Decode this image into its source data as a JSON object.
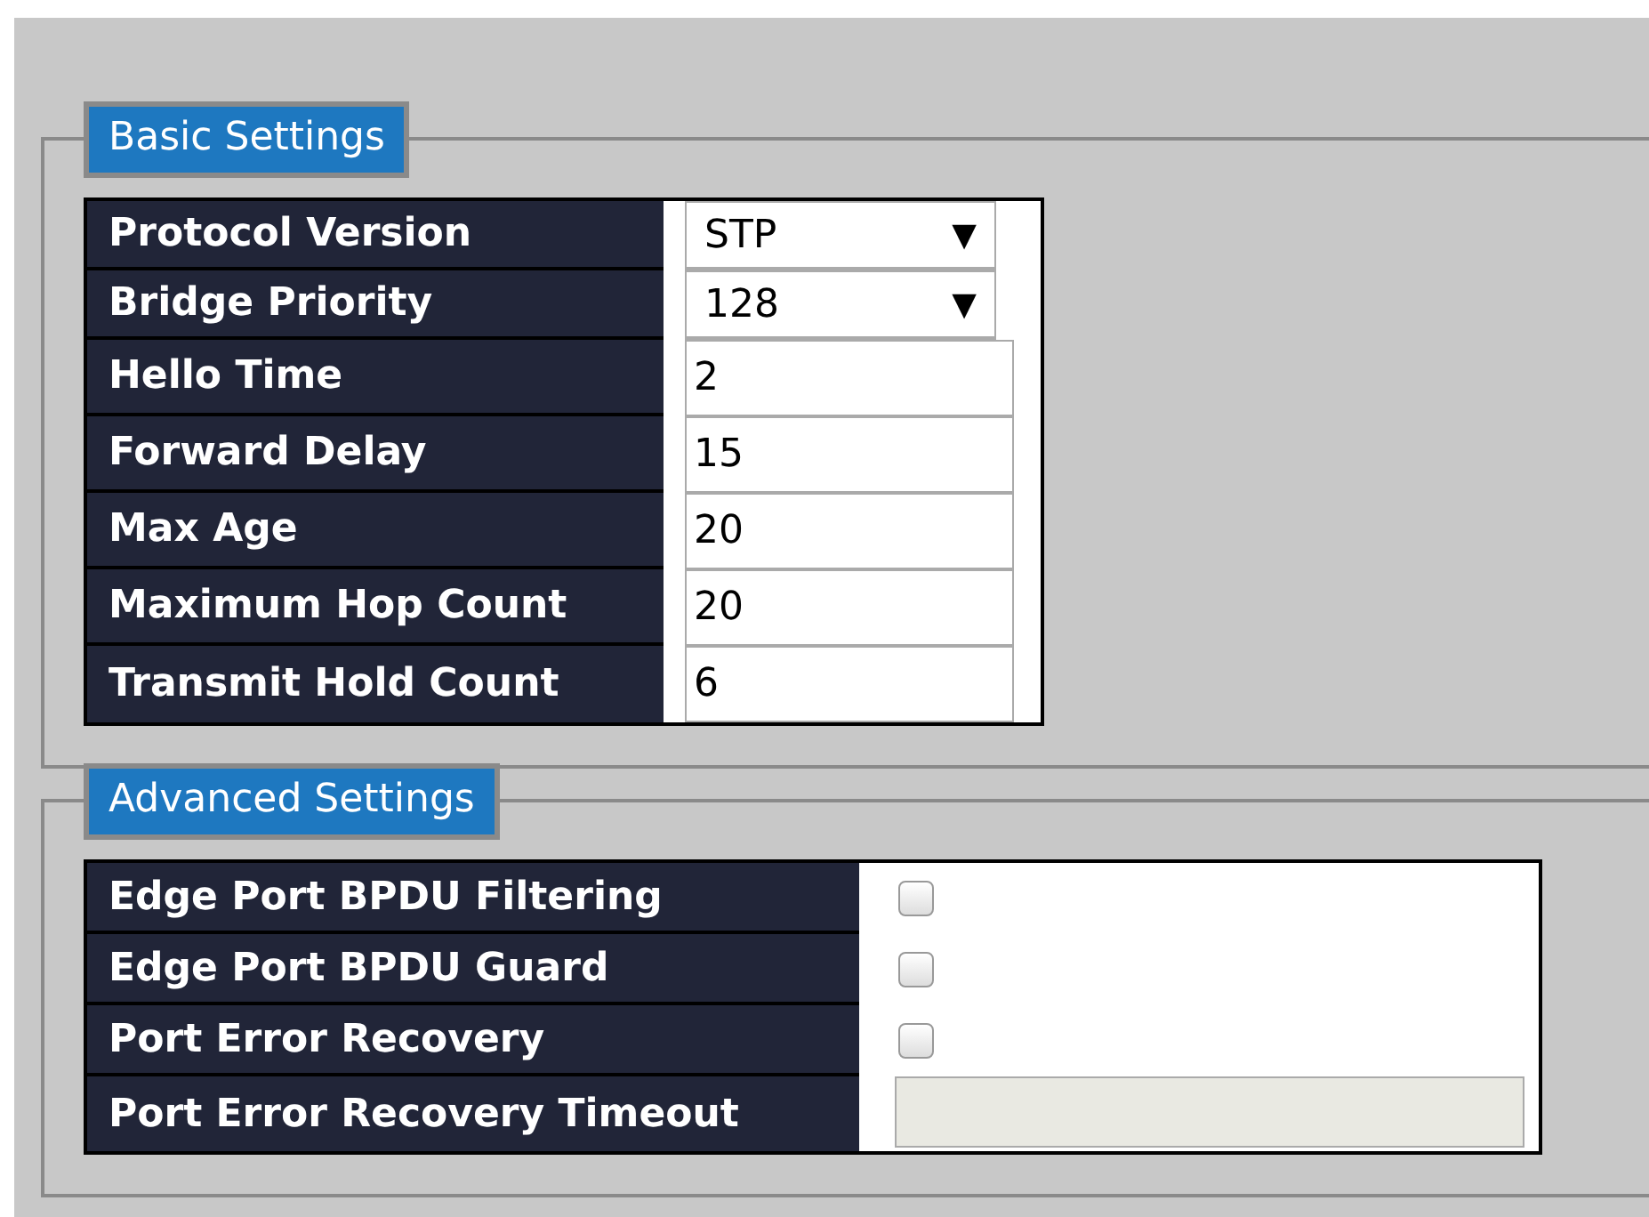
{
  "sections": [
    {
      "title": "Basic Settings",
      "rows": [
        {
          "label": "Protocol Version",
          "kind": "select",
          "value": "STP",
          "caret": "▼"
        },
        {
          "label": "Bridge Priority",
          "kind": "select",
          "value": "128",
          "caret": "▼"
        },
        {
          "label": "Hello Time",
          "kind": "text",
          "value": "2",
          "disabled": false
        },
        {
          "label": "Forward Delay",
          "kind": "text",
          "value": "15",
          "disabled": false
        },
        {
          "label": "Max Age",
          "kind": "text",
          "value": "20",
          "disabled": false
        },
        {
          "label": "Maximum Hop Count",
          "kind": "text",
          "value": "20",
          "disabled": false
        },
        {
          "label": "Transmit Hold Count",
          "kind": "text",
          "value": "6",
          "disabled": false
        }
      ]
    },
    {
      "title": "Advanced Settings",
      "rows": [
        {
          "label": "Edge Port BPDU Filtering",
          "kind": "checkbox",
          "checked": false
        },
        {
          "label": "Edge Port BPDU Guard",
          "kind": "checkbox",
          "checked": false
        },
        {
          "label": "Port Error Recovery",
          "kind": "checkbox",
          "checked": false
        },
        {
          "label": "Port Error Recovery Timeout",
          "kind": "text",
          "disabled": true
        }
      ]
    }
  ]
}
